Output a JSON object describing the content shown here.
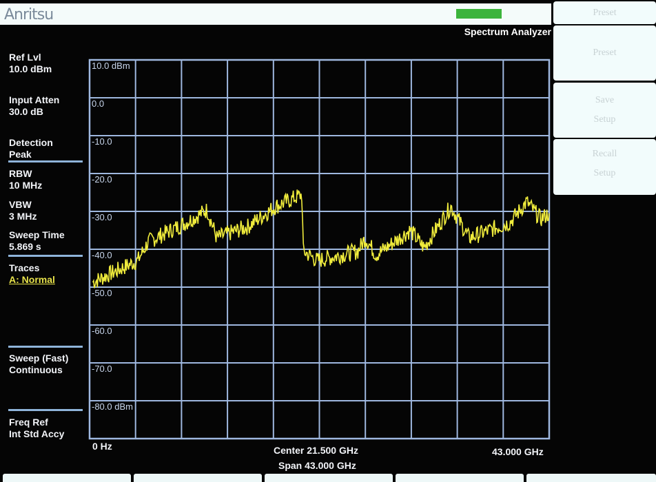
{
  "header": {
    "logo": "Anritsu",
    "mode": "Spectrum Analyzer"
  },
  "softkeys": [
    {
      "label": "Preset"
    },
    {
      "label": "Preset"
    },
    {
      "label": "Save",
      "label2": "Setup"
    },
    {
      "label": "Recall",
      "label2": "Setup"
    }
  ],
  "left_panel": {
    "ref_lvl": {
      "label": "Ref Lvl",
      "value": "10.0 dBm"
    },
    "input_atten": {
      "label": "Input Atten",
      "value": "30.0 dB"
    },
    "detection": {
      "label": "Detection",
      "value": "Peak"
    },
    "rbw": {
      "label": "RBW",
      "value": "10 MHz"
    },
    "vbw": {
      "label": "VBW",
      "value": "3 MHz"
    },
    "sweep_time": {
      "label": "Sweep Time",
      "value": "5.869 s"
    },
    "traces": {
      "label": "Traces",
      "value": "A: Normal"
    },
    "sweep": {
      "label": "Sweep (Fast)",
      "value": "Continuous"
    },
    "freq_ref": {
      "label": "Freq Ref",
      "value": "Int Std Accy"
    }
  },
  "colors": {
    "trace": "#f0ec3c",
    "grid": "#9fb8e0",
    "led": "#3cb43c"
  },
  "chart_data": {
    "type": "line",
    "xlabel_start": "0 Hz",
    "xlabel_center": "Center 21.500 GHz",
    "xlabel_span": "Span 43.000 GHz",
    "xlabel_stop": "43.000 GHz",
    "xlim": [
      0,
      43
    ],
    "ylim": [
      -90,
      10
    ],
    "grid": true,
    "y_tick_labels": [
      "10.0 dBm",
      "0.0",
      "-10.0",
      "-20.0",
      "-30.0",
      "-40.0",
      "-50.0",
      "-60.0",
      "-70.0",
      "-80.0 dBm"
    ],
    "series": [
      {
        "name": "A: Normal",
        "x": [
          0.3,
          4.5,
          5.5,
          9.0,
          11.0,
          11.9,
          14.8,
          17.4,
          19.85,
          20.0,
          21.3,
          25.1,
          25.8,
          26.8,
          30.0,
          31.3,
          33.8,
          35.5,
          39.3,
          40.9,
          42.2,
          43.0
        ],
        "y": [
          -48.7,
          -43,
          -38,
          -33,
          -29.6,
          -37,
          -34,
          -28.7,
          -25.6,
          -40.5,
          -43,
          -40.5,
          -37,
          -41.5,
          -35,
          -39.6,
          -28.7,
          -37,
          -33,
          -27.5,
          -32,
          -30.5
        ]
      }
    ]
  }
}
